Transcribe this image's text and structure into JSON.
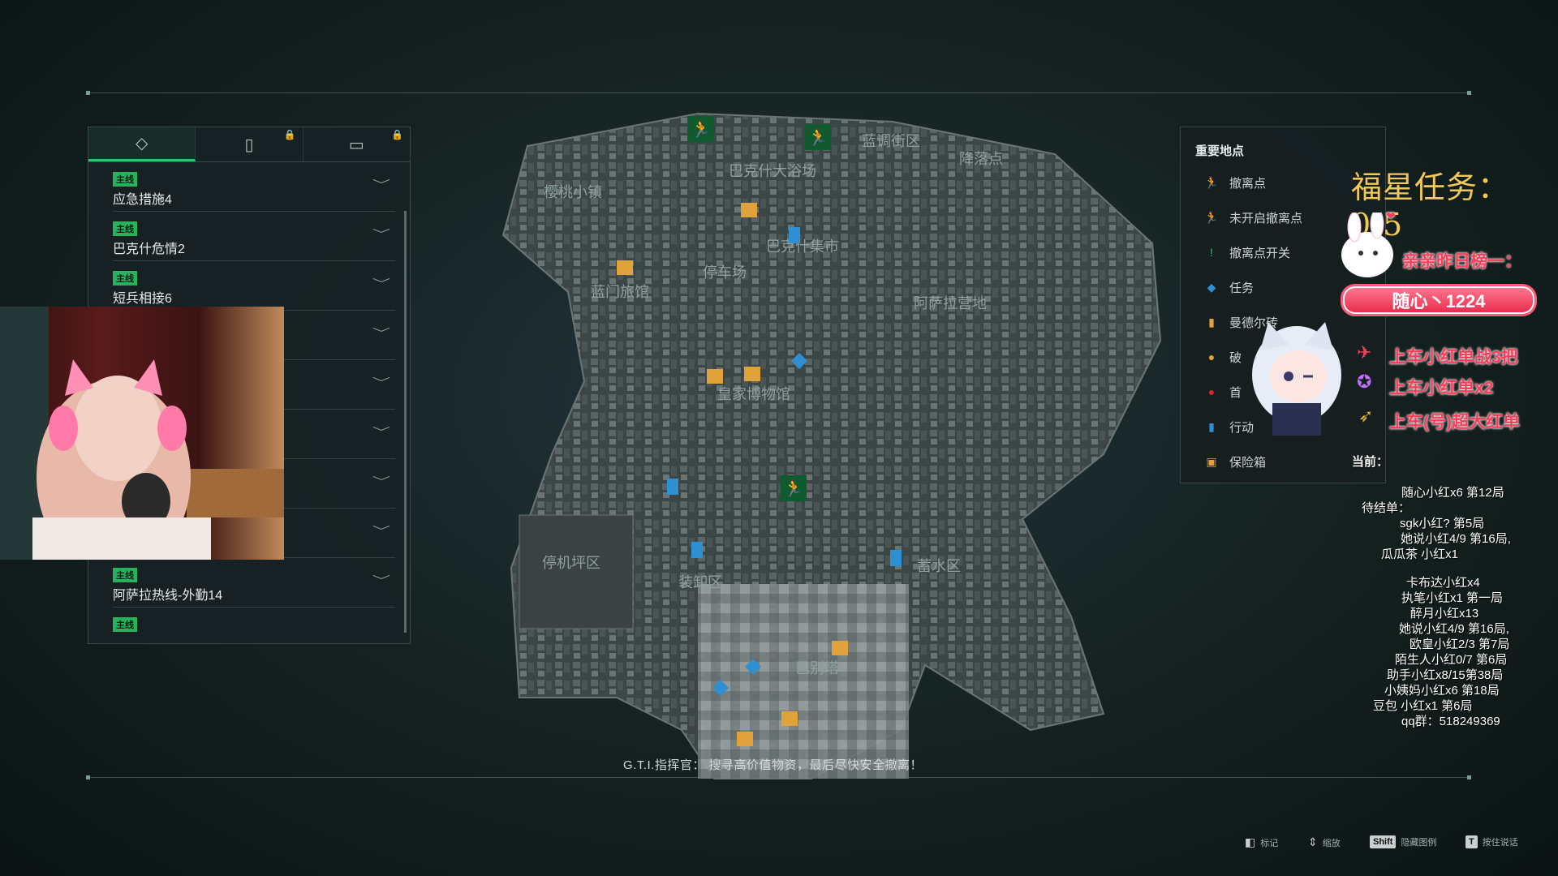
{
  "map_labels": [
    "樱桃小镇",
    "巴克什大浴场",
    "蓝调街区",
    "降落点",
    "巴克什集市",
    "停车场",
    "蓝门旅馆",
    "阿萨拉营地",
    "皇家博物馆",
    "停机坪区",
    "装卸区",
    "蓄水区",
    "巴别塔"
  ],
  "quest_tabs": [
    {
      "icon": "diamond-exclamation-icon",
      "locked": false
    },
    {
      "icon": "card-icon",
      "locked": true,
      "lock_icon": "🔒"
    },
    {
      "icon": "calendar-icon",
      "locked": true,
      "lock_icon": "🔒"
    }
  ],
  "quest_tab_glyphs": [
    "◇",
    "▯",
    "▭"
  ],
  "quests": [
    {
      "badge": "主线",
      "name": "应急措施4"
    },
    {
      "badge": "主线",
      "name": "巴克什危情2"
    },
    {
      "badge": "主线",
      "name": "短兵相接6"
    },
    {
      "badge": "",
      "name": ""
    },
    {
      "badge": "",
      "name": ""
    },
    {
      "badge": "",
      "name": ""
    },
    {
      "badge": "",
      "name": ""
    },
    {
      "badge": "",
      "name": ""
    },
    {
      "badge": "主线",
      "name": "阿萨拉热线-外勤14"
    },
    {
      "badge": "主线",
      "name": ""
    }
  ],
  "chevron": "﹀",
  "legend": {
    "title": "重要地点",
    "items": [
      {
        "icon": "running-exit-icon",
        "glyph": "🏃",
        "color": "#31c56b",
        "label": "撤离点"
      },
      {
        "icon": "inactive-exit-icon",
        "glyph": "🏃",
        "color": "#8a9494",
        "label": "未开启撤离点"
      },
      {
        "icon": "exit-switch-icon",
        "glyph": "!",
        "color": "#31c56b",
        "label": "撤离点开关"
      },
      {
        "icon": "mission-icon",
        "glyph": "◆",
        "color": "#2f8fd0",
        "label": "任务"
      },
      {
        "icon": "mandel-brick-icon",
        "glyph": "▮",
        "color": "#e0a23a",
        "label": "曼德尔砖"
      },
      {
        "icon": "break-icon",
        "glyph": "●",
        "color": "#e0a23a",
        "label": "破"
      },
      {
        "icon": "boss-icon",
        "glyph": "●",
        "color": "#d02a2a",
        "label": "首"
      },
      {
        "icon": "action-icon",
        "glyph": "▮",
        "color": "#2f8fd0",
        "label": "行动"
      },
      {
        "icon": "safe-icon",
        "glyph": "▣",
        "color": "#e0a23a",
        "label": "保险箱"
      }
    ]
  },
  "overlay": {
    "fuxing": "福星任务：0/5",
    "ranking_title": "亲亲昨日榜一：",
    "ranking_name": "随心丶1224",
    "heart": "❤",
    "lines": [
      "上车小红单战3把",
      "上车小红单x2",
      "上车(号)超大红单"
    ],
    "line_icons": [
      "jet-icon",
      "medal-icon",
      "rocket-icon"
    ],
    "current_label": "当前：",
    "current_value": "随心小红x6 第12局",
    "pending_label": "待结单：",
    "pending": [
      "sgk小红? 第5局",
      "她说小红4/9 第16局,",
      "瓜瓜茶 小红x1"
    ],
    "queue": [
      "卡布达小红x4",
      "执笔小红x1 第一局",
      "醉月小红x13",
      "她说小红4/9 第16局,",
      "欧皇小红2/3 第7局",
      "陌生人小红0/7 第6局",
      "助手小红x8/15第38局",
      "小姨妈小红x6 第18局",
      "豆包 小红x1  第6局",
      "qq群：518249369"
    ]
  },
  "commander": "G.T.I.指挥官：  搜寻高价值物资，最后尽快安全撤离！",
  "hints": [
    {
      "key": "",
      "icon": "mouse-icon",
      "glyph": "◧",
      "label": "标记"
    },
    {
      "key": "",
      "icon": "scroll-icon",
      "glyph": "⇕",
      "label": "缩放"
    },
    {
      "key": "Shift",
      "icon": "",
      "glyph": "",
      "label": "隐藏图例"
    },
    {
      "key": "T",
      "icon": "",
      "glyph": "",
      "label": "按住说话"
    }
  ],
  "colors": {
    "accent": "#31c56b",
    "overlay_red": "#ff3d5a",
    "gold": "#f2c857"
  }
}
